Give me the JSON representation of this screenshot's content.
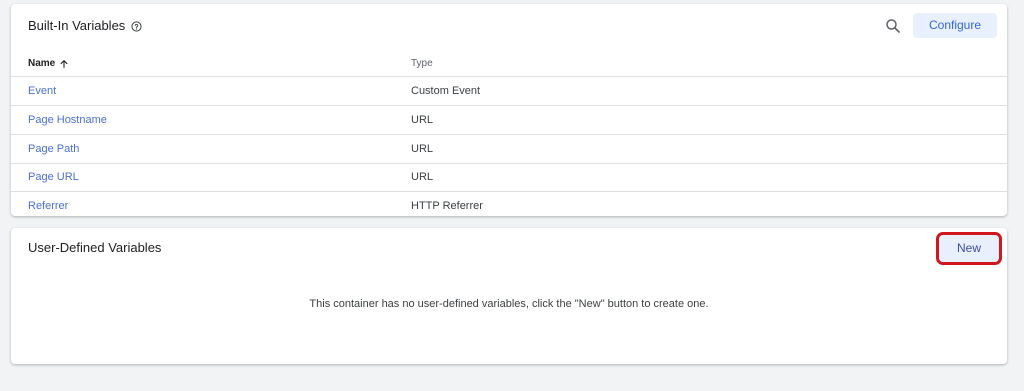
{
  "builtin": {
    "title": "Built-In Variables",
    "configure_label": "Configure",
    "header_name": "Name",
    "header_type": "Type",
    "rows": [
      {
        "name": "Event",
        "type": "Custom Event"
      },
      {
        "name": "Page Hostname",
        "type": "URL"
      },
      {
        "name": "Page Path",
        "type": "URL"
      },
      {
        "name": "Page URL",
        "type": "URL"
      },
      {
        "name": "Referrer",
        "type": "HTTP Referrer"
      }
    ]
  },
  "user_defined": {
    "title": "User-Defined Variables",
    "new_label": "New",
    "empty_message": "This container has no user-defined variables, click the \"New\" button to create one."
  },
  "icons": {
    "help": "help-icon",
    "search": "search-icon",
    "sort": "arrow-up-icon"
  },
  "colors": {
    "accent": "#1a73e8",
    "button_bg": "#e8f0fe",
    "highlight": "#d0161e"
  }
}
